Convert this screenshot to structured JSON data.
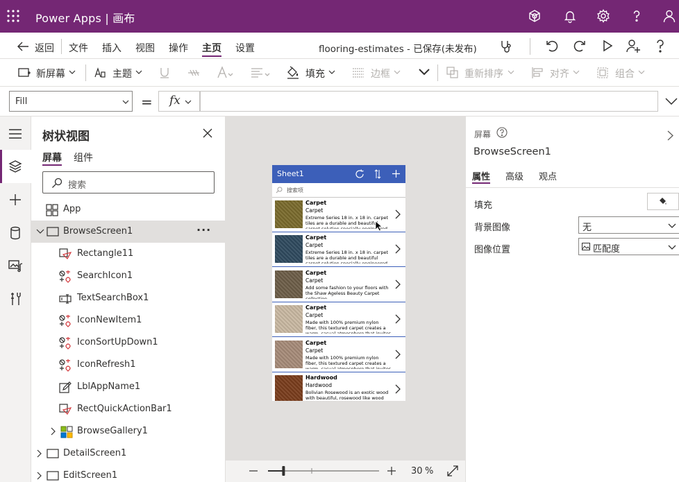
{
  "app": {
    "title": "Power Apps | 画布"
  },
  "menu": {
    "back": "返回",
    "items": [
      "文件",
      "插入",
      "视图",
      "操作",
      "主页",
      "设置"
    ],
    "active": "主页",
    "doc_title": "flooring-estimates - 已保存(未发布)"
  },
  "ribbon": {
    "new_screen": "新屏幕",
    "theme": "主题",
    "fill": "填充",
    "border": "边框",
    "reorder": "重新排序",
    "align": "对齐",
    "group": "组合"
  },
  "formula": {
    "property": "Fill",
    "equals": "=",
    "fx": "fx",
    "value": ""
  },
  "tree": {
    "title": "树状视图",
    "tabs": [
      "屏幕",
      "组件"
    ],
    "active_tab": "屏幕",
    "search_placeholder": "搜索",
    "app_label": "App",
    "screen": "BrowseScreen1",
    "screen_menu": "···",
    "children": [
      "Rectangle11",
      "SearchIcon1",
      "TextSearchBox1",
      "IconNewItem1",
      "IconSortUpDown1",
      "IconRefresh1",
      "LblAppName1",
      "RectQuickActionBar1",
      "BrowseGallery1"
    ],
    "other_screens": [
      "DetailScreen1",
      "EditScreen1"
    ]
  },
  "phone": {
    "header": "Sheet1",
    "search_placeholder": "搜索项",
    "items": [
      {
        "title": "Carpet",
        "subtitle": "Carpet",
        "desc": "Extreme Series 18 in. x 18 in. carpet tiles are a durable and beautiful carpet solution specially engineered for both",
        "color": "#7a6a2c"
      },
      {
        "title": "Carpet",
        "subtitle": "Carpet",
        "desc": "Extreme Series 18 in. x 18 in. carpet tiles are a durable and beautiful carpet solution specially engineered for both",
        "color": "#2f4a5e"
      },
      {
        "title": "Carpet",
        "subtitle": "Carpet",
        "desc": "Add some fashion to your floors with the Shaw Ageless Beauty Carpet collection.",
        "color": "#6d5d48"
      },
      {
        "title": "Carpet",
        "subtitle": "Carpet",
        "desc": "Made with 100% premium nylon fiber, this textured carpet creates a warm, casual atmosphere that invites you to",
        "color": "#c9b8a2"
      },
      {
        "title": "Carpet",
        "subtitle": "Carpet",
        "desc": "Made with 100% premium nylon fiber, this textured carpet creates a warm, casual atmosphere that invites you to",
        "color": "#a68b78"
      },
      {
        "title": "Hardwood",
        "subtitle": "Hardwood",
        "desc": "Bolivian Rosewood is an exotic wood with beautiful, rosewood like wood with",
        "color": "#7a3d1c"
      }
    ]
  },
  "zoom": {
    "value": "30",
    "unit": "%",
    "level": 0.3
  },
  "props": {
    "section": "屏幕",
    "name": "BrowseScreen1",
    "tabs": [
      "属性",
      "高级",
      "观点"
    ],
    "active_tab": "属性",
    "fill_label": "填充",
    "bg_image_label": "背景图像",
    "bg_image_value": "无",
    "image_pos_label": "图像位置",
    "image_pos_value": "匹配度"
  },
  "colors": {
    "brand": "#742774",
    "gallery_header": "#3c5fb9"
  }
}
